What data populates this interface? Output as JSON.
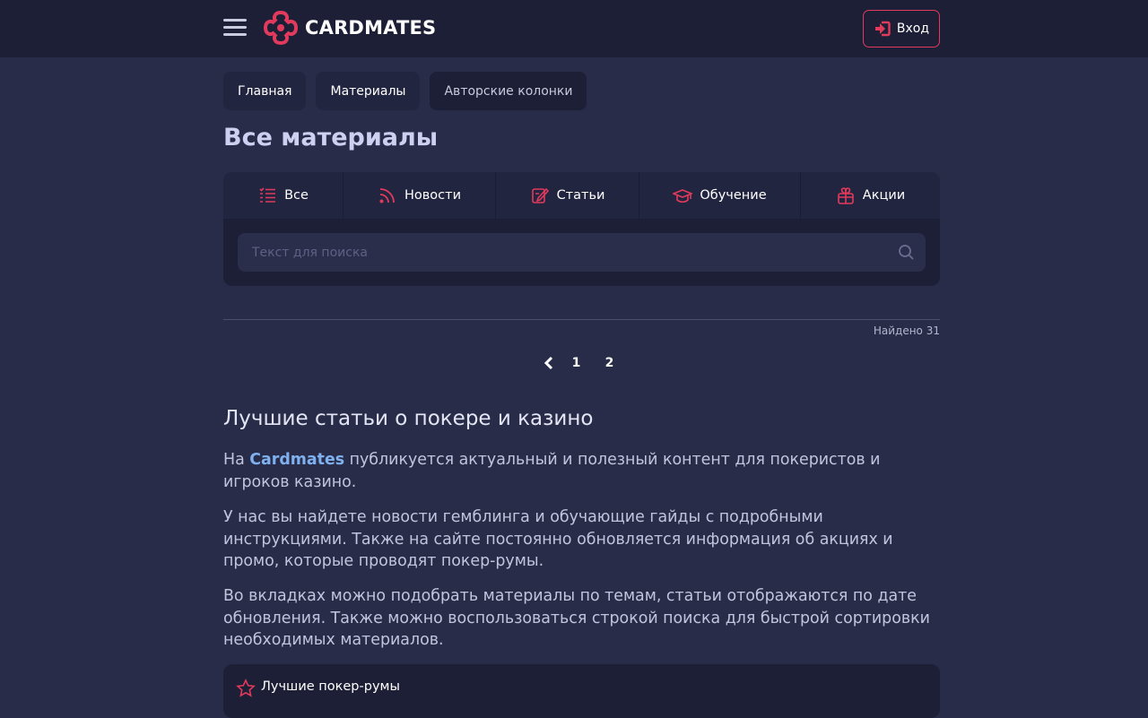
{
  "header": {
    "logo_text": "CARDMATES",
    "login_label": "Вход"
  },
  "breadcrumb": [
    {
      "label": "Главная"
    },
    {
      "label": "Материалы"
    },
    {
      "label": "Авторские колонки"
    }
  ],
  "page_title": "Все материалы",
  "tabs": [
    {
      "label": "Все",
      "icon": "list-icon"
    },
    {
      "label": "Новости",
      "icon": "rss-icon"
    },
    {
      "label": "Статьи",
      "icon": "edit-article-icon"
    },
    {
      "label": "Обучение",
      "icon": "graduation-cap-icon"
    },
    {
      "label": "Акции",
      "icon": "gift-icon"
    }
  ],
  "search": {
    "placeholder": "Текст для поиска"
  },
  "results": {
    "found_text": "Найдено 31"
  },
  "pagination": {
    "pages": [
      "1",
      "2"
    ]
  },
  "content": {
    "title": "Лучшие статьи о покере и казино",
    "p1_prefix": "На ",
    "p1_link": "Cardmates",
    "p1_suffix": " публикуется актуальный и полезный контент для покеристов и игроков казино.",
    "p2": "У нас вы найдете новости гемблинга и обучающие гайды с подробными инструкциями. Также на сайте постоянно обновляется информация об акциях и промо, которые проводят покер-румы.",
    "p3": "Во вкладках можно подобрать материалы по темам, статьи отображаются по дате обновления. Также можно воспользоваться строкой поиска для быстрой сортировки необходимых материалов.",
    "bottom_card_label": "Лучшие покер-румы"
  },
  "colors": {
    "accent": "#e23a5c",
    "background": "#292c49",
    "header": "#1c1f35",
    "link": "#7fb1f0"
  }
}
